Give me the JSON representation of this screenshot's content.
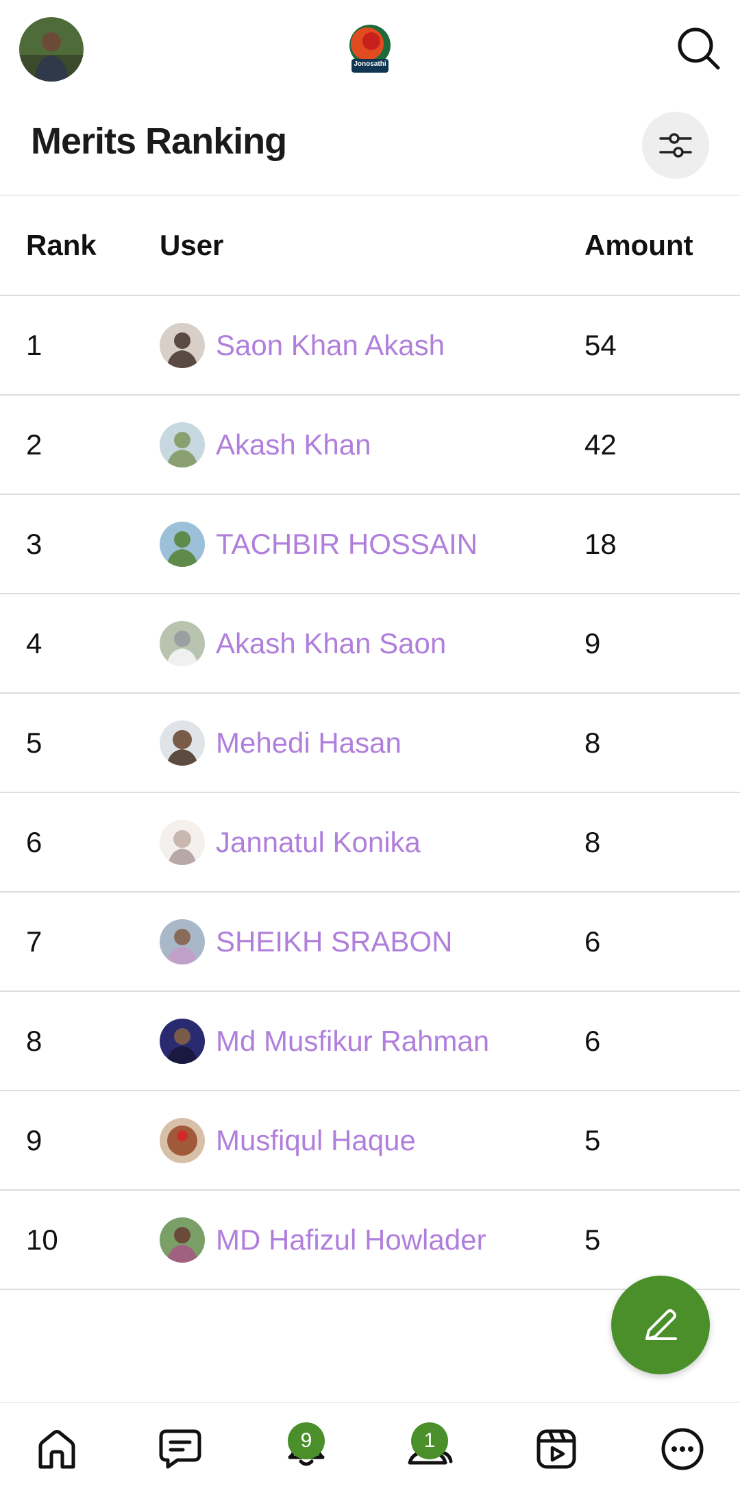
{
  "app": {
    "logo_text": "Jonosathi"
  },
  "header": {
    "title": "Merits Ranking"
  },
  "table": {
    "columns": [
      "Rank",
      "User",
      "Amount"
    ],
    "rows": [
      {
        "rank": "1",
        "user": "Saon Khan Akash",
        "amount": "54",
        "avatar_color": "#5a4a42"
      },
      {
        "rank": "2",
        "user": "Akash Khan",
        "amount": "42",
        "avatar_color": "#8aa070"
      },
      {
        "rank": "3",
        "user": "TACHBIR HOSSAIN",
        "amount": "18",
        "avatar_color": "#5f8b4a"
      },
      {
        "rank": "4",
        "user": "Akash Khan Saon",
        "amount": "9",
        "avatar_color": "#9aa0a0"
      },
      {
        "rank": "5",
        "user": "Mehedi Hasan",
        "amount": "8",
        "avatar_color": "#7a5a48"
      },
      {
        "rank": "6",
        "user": "Jannatul Konika",
        "amount": "8",
        "avatar_color": "#c8b8b0"
      },
      {
        "rank": "7",
        "user": "SHEIKH SRABON",
        "amount": "6",
        "avatar_color": "#c0a0c8"
      },
      {
        "rank": "8",
        "user": "Md Musfikur Rahman",
        "amount": "6",
        "avatar_color": "#2a2a70"
      },
      {
        "rank": "9",
        "user": "Musfiqul Haque",
        "amount": "5",
        "avatar_color": "#a05a3a"
      },
      {
        "rank": "10",
        "user": "MD Hafizul Howlader",
        "amount": "5",
        "avatar_color": "#6a8a5a"
      }
    ]
  },
  "bottom_nav": {
    "items": [
      {
        "icon": "home-icon"
      },
      {
        "icon": "chat-icon"
      },
      {
        "icon": "notifications-icon",
        "badge": "9"
      },
      {
        "icon": "people-icon",
        "badge": "1"
      },
      {
        "icon": "reels-icon"
      },
      {
        "icon": "more-icon"
      }
    ]
  },
  "colors": {
    "accent": "#4a8f2a",
    "username": "#b07fdb"
  }
}
